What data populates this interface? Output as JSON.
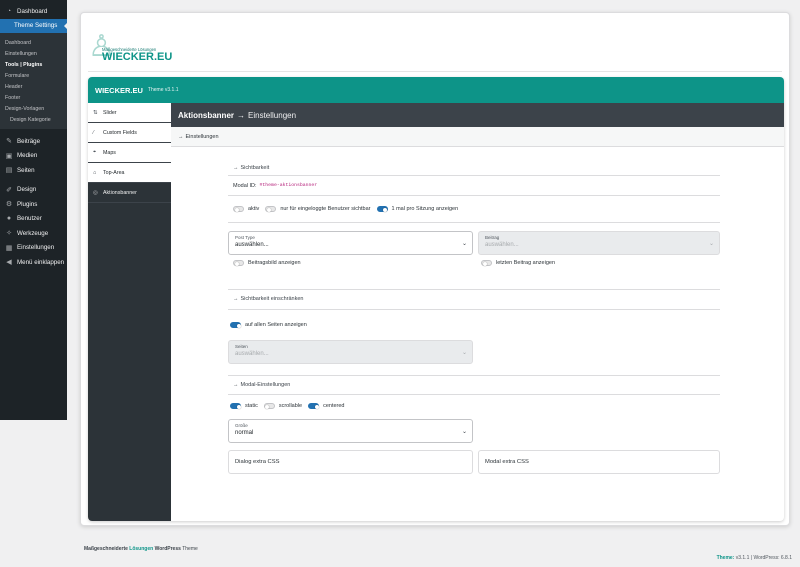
{
  "wp_menu": {
    "dashboard": "Dashboard",
    "theme_settings": "Theme Settings",
    "submenu": [
      "Dashboard",
      "Einstellungen",
      "Tools | Plugins",
      "Formulare",
      "Header",
      "Footer",
      "Design-Vorlagen",
      "Design Kategorie"
    ],
    "items": [
      "Beiträge",
      "Medien",
      "Seiten",
      "Design",
      "Plugins",
      "Benutzer",
      "Werkzeuge",
      "Einstellungen",
      "Menü einklappen"
    ]
  },
  "logo": {
    "tagline": "Maßgeschneiderte Lösungen",
    "name": "WIECKER.EU"
  },
  "panel": {
    "title": "WIECKER.EU",
    "version": "Theme v3.1.1"
  },
  "sidebar": [
    {
      "icon": "⇅",
      "label": "Slider"
    },
    {
      "icon": "⁄",
      "label": "Custom Fields"
    },
    {
      "icon": "⌖",
      "label": "Maps"
    },
    {
      "icon": "⌂",
      "label": "Top-Area"
    },
    {
      "icon": "◎",
      "label": "Aktionsbanner"
    }
  ],
  "main": {
    "title": "Aktionsbanner",
    "arrow": "→",
    "subtitle": "Einstellungen",
    "tab": "Einstellungen"
  },
  "form": {
    "sichtbarkeit": "Sichtbarkeit",
    "modal_id_label": "Modal ID:",
    "modal_id_value": "#theme-aktionsbanner",
    "toggles1": [
      {
        "label": "aktiv",
        "on": false
      },
      {
        "label": "nur für eingeloggte Benutzer sichtbar",
        "on": false
      },
      {
        "label": "1 mal pro Sitzung anzeigen",
        "on": true
      }
    ],
    "post_type": {
      "label": "Post Type",
      "value": "auswählen..."
    },
    "beitrag": {
      "label": "Beitrag",
      "value": "auswählen..."
    },
    "beitragsbild": "Beitragsbild anzeigen",
    "letzten": "letzten Beitrag anzeigen",
    "einschraenken": "Sichtbarkeit einschränken",
    "alle_seiten": "auf allen Seiten anzeigen",
    "seiten": {
      "label": "Seiten",
      "value": "auswählen..."
    },
    "modal_settings": "Modal-Einstellungen",
    "toggles2": [
      {
        "label": "static",
        "on": true
      },
      {
        "label": "scrollable",
        "on": false
      },
      {
        "label": "centered",
        "on": true
      }
    ],
    "groesse": {
      "label": "Größe",
      "value": "normal"
    },
    "dialog_css": "Dialog extra CSS",
    "modal_css": "Modal extra CSS"
  },
  "footer": {
    "left_a": "Maßgeschneiderte",
    "left_b": "Lösungen",
    "left_c": "WordPress",
    "left_d": "Theme",
    "right_theme": "Theme:",
    "right_ver": "v3.1.1",
    "right_wp": "WordPress: 6.8.1"
  }
}
